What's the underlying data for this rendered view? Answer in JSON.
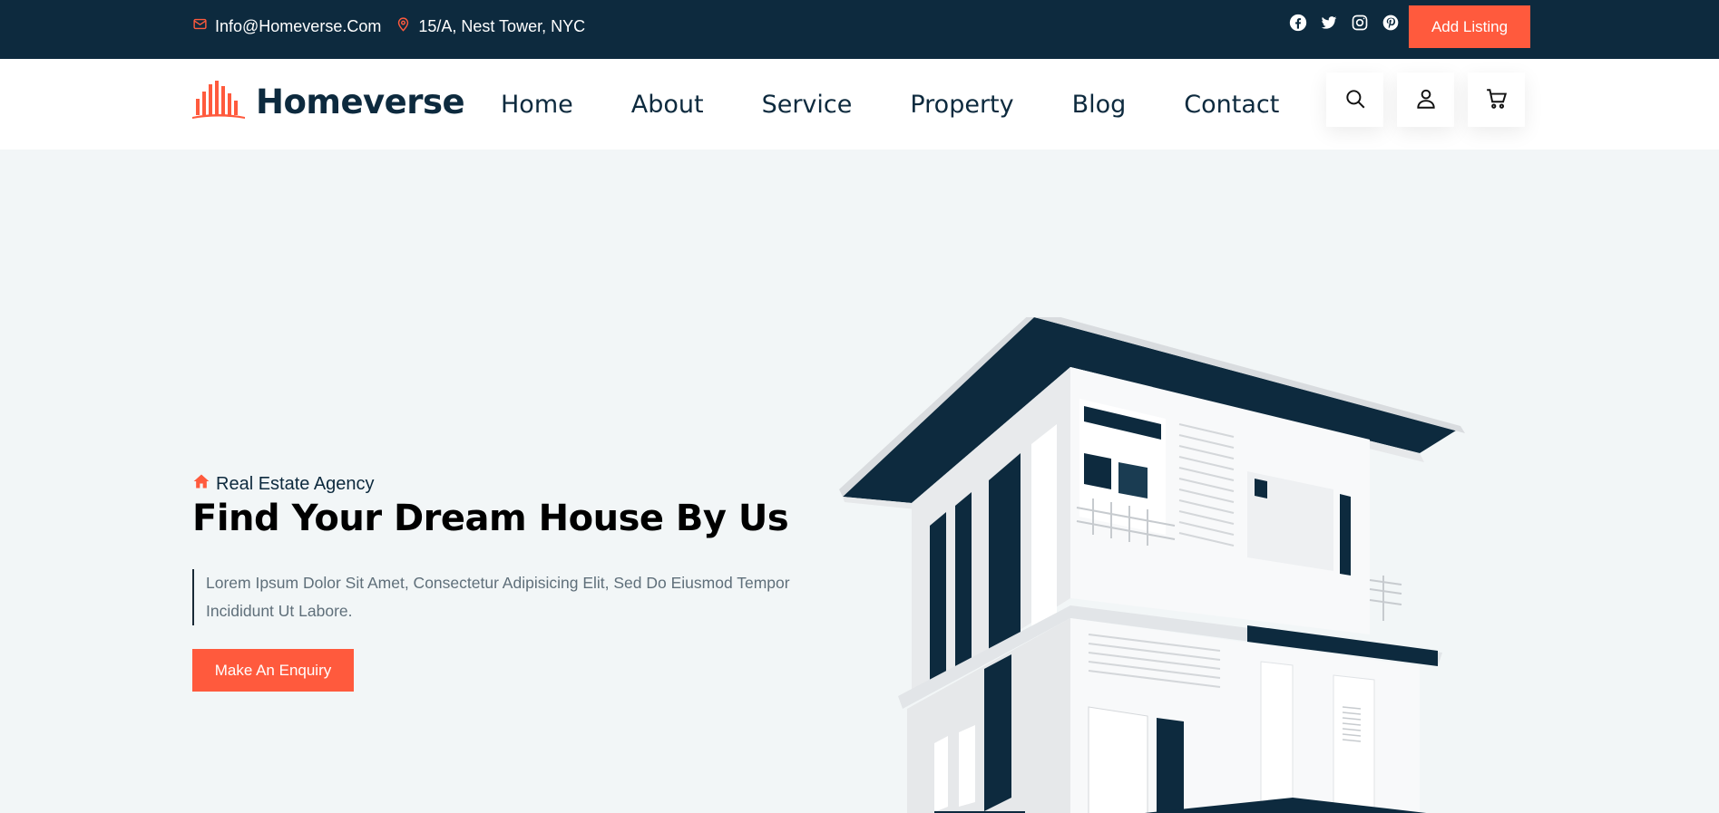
{
  "topbar": {
    "email": "Info@Homeverse.Com",
    "address": "15/A, Nest Tower, NYC",
    "social_icons": [
      "facebook-icon",
      "twitter-icon",
      "instagram-icon",
      "pinterest-icon"
    ],
    "add_listing_label": "Add Listing"
  },
  "header": {
    "logo_text": "Homeverse",
    "nav": [
      {
        "label": "Home"
      },
      {
        "label": "About"
      },
      {
        "label": "Service"
      },
      {
        "label": "Property"
      },
      {
        "label": "Blog"
      },
      {
        "label": "Contact"
      }
    ],
    "action_icons": [
      "search-icon",
      "user-icon",
      "cart-icon"
    ]
  },
  "hero": {
    "subtitle": "Real Estate Agency",
    "title": "Find Your Dream House By Us",
    "text": "Lorem Ipsum Dolor Sit Amet, Consectetur Adipisicing Elit, Sed Do Eiusmod Tempor Incididunt Ut Labore.",
    "button_label": "Make An Enquiry"
  },
  "colors": {
    "primary_dark": "#0d2a3e",
    "accent": "#ff5a3d",
    "hero_bg": "#f2f6f7"
  }
}
